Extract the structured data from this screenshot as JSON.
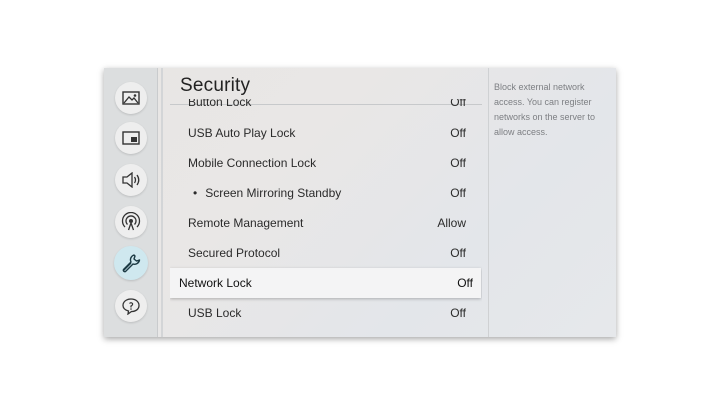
{
  "page": {
    "title": "Security"
  },
  "sidebar": {
    "items": [
      {
        "icon": "picture-icon"
      },
      {
        "icon": "display-mode-icon"
      },
      {
        "icon": "sound-icon"
      },
      {
        "icon": "broadcast-icon"
      },
      {
        "icon": "wrench-icon",
        "active": true
      },
      {
        "icon": "support-icon"
      }
    ]
  },
  "settings": {
    "rows": [
      {
        "label": "Button Lock",
        "value": "Off"
      },
      {
        "label": "USB Auto Play Lock",
        "value": "Off"
      },
      {
        "label": "Mobile Connection Lock",
        "value": "Off"
      },
      {
        "label": "Screen Mirroring Standby",
        "value": "Off",
        "bullet": "•"
      },
      {
        "label": "Remote Management",
        "value": "Allow"
      },
      {
        "label": "Secured Protocol",
        "value": "Off"
      },
      {
        "label": "Network Lock",
        "value": "Off"
      },
      {
        "label": "USB Lock",
        "value": "Off"
      }
    ]
  },
  "help": {
    "text": "Block external network access. You can register networks on the server to allow access."
  },
  "colors": {
    "accent": "#cfe8ef",
    "focus": "#f4f4f5"
  }
}
